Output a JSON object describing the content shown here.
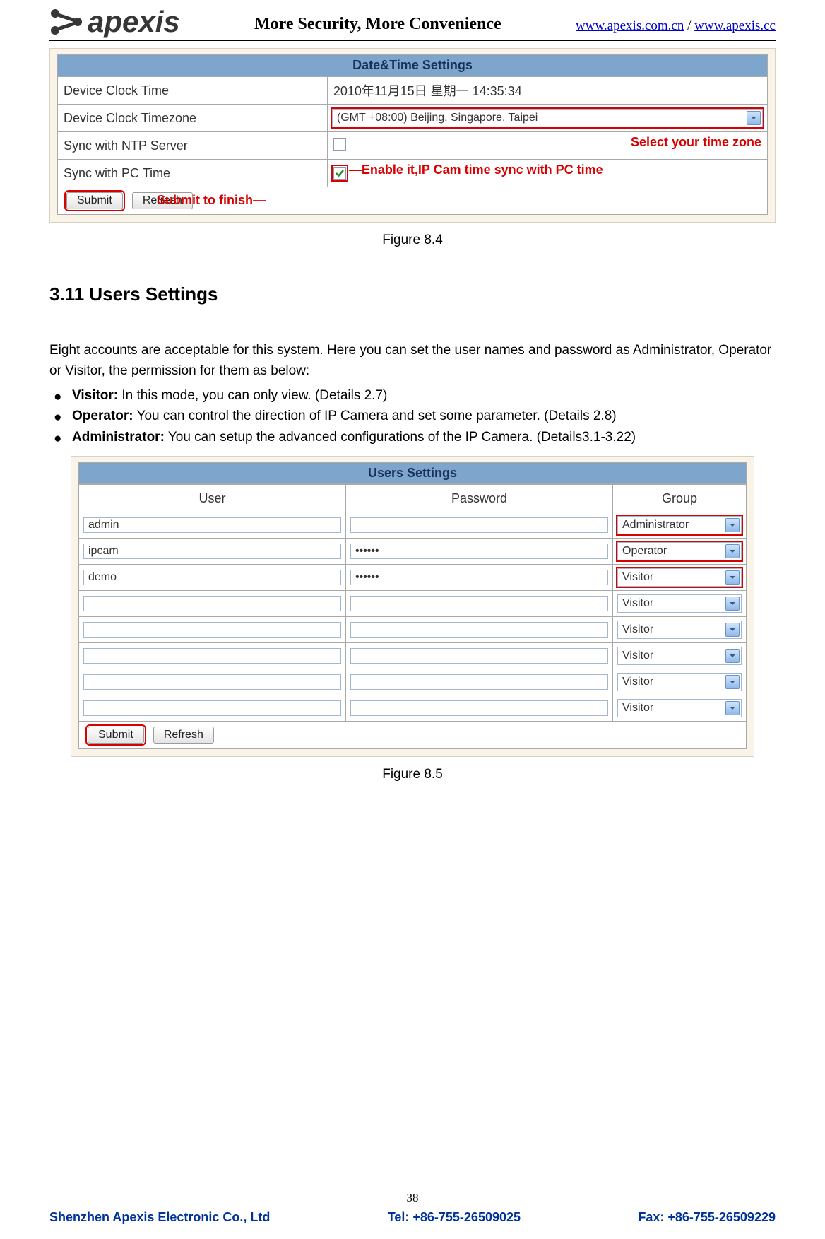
{
  "header": {
    "brand": "apexis",
    "tagline": "More Security, More Convenience",
    "link1": "www.apexis.com.cn",
    "link2": "www.apexis.cc",
    "slash": " / "
  },
  "fig84": {
    "title": "Date&Time Settings",
    "rows": {
      "clock_time_label": "Device Clock Time",
      "clock_time_value": "2010年11月15日  星期一  14:35:34",
      "tz_label": "Device Clock Timezone",
      "tz_value": "(GMT +08:00) Beijing, Singapore, Taipei",
      "ntp_label": "Sync with NTP Server",
      "pc_label": "Sync with PC Time"
    },
    "submit": "Submit",
    "refresh": "Refresh",
    "annot_tz": "Select your time zone",
    "annot_pc": "Enable it,IP Cam time sync with PC time",
    "annot_submit": "Submit to finish",
    "caption": "Figure 8.4"
  },
  "section": {
    "heading": "3.11 Users Settings",
    "intro": "Eight accounts are acceptable for this system. Here you can set the user names and password as Administrator, Operator or Visitor, the permission for them as below:",
    "roles": [
      {
        "name": "Visitor:",
        "desc": " In this mode, you can only view. (Details 2.7)"
      },
      {
        "name": "Operator:",
        "desc": " You can control the direction of IP Camera and set some parameter. (Details 2.8)"
      },
      {
        "name": "Administrator:",
        "desc": " You can setup the advanced configurations of the IP Camera. (Details3.1-3.22)"
      }
    ]
  },
  "fig85": {
    "title": "Users Settings",
    "headers": {
      "user": "User",
      "password": "Password",
      "group": "Group"
    },
    "rows": [
      {
        "user": "admin",
        "password": "",
        "group": "Administrator",
        "hl": true
      },
      {
        "user": "ipcam",
        "password": "••••••",
        "group": "Operator",
        "hl": true
      },
      {
        "user": "demo",
        "password": "••••••",
        "group": "Visitor",
        "hl": true
      },
      {
        "user": "",
        "password": "",
        "group": "Visitor",
        "hl": false
      },
      {
        "user": "",
        "password": "",
        "group": "Visitor",
        "hl": false
      },
      {
        "user": "",
        "password": "",
        "group": "Visitor",
        "hl": false
      },
      {
        "user": "",
        "password": "",
        "group": "Visitor",
        "hl": false
      },
      {
        "user": "",
        "password": "",
        "group": "Visitor",
        "hl": false
      }
    ],
    "submit": "Submit",
    "refresh": "Refresh",
    "caption": "Figure 8.5"
  },
  "footer": {
    "page": "38",
    "company": "Shenzhen Apexis Electronic Co., Ltd",
    "tel": "Tel: +86-755-26509025",
    "fax": "Fax: +86-755-26509229"
  }
}
